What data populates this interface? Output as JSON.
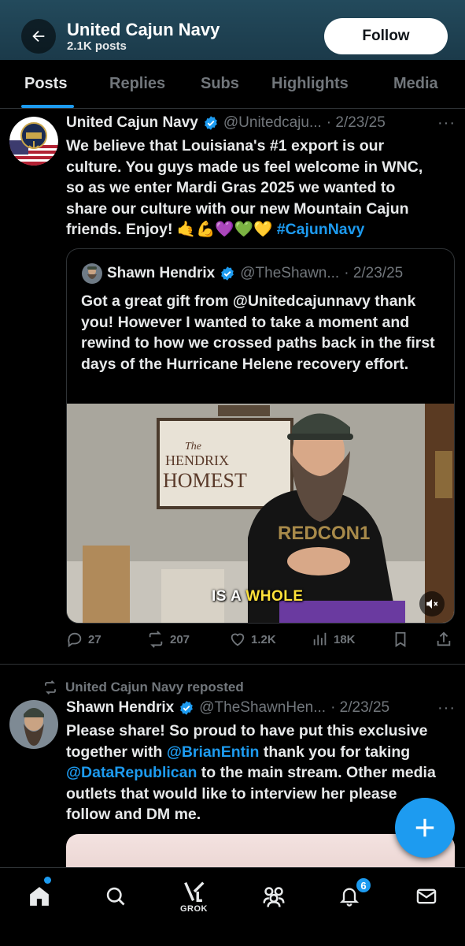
{
  "header": {
    "title": "United Cajun Navy",
    "posts_count": "2.1K posts",
    "follow_label": "Follow"
  },
  "tabs": [
    {
      "label": "Posts",
      "active": true
    },
    {
      "label": "Replies",
      "active": false
    },
    {
      "label": "Subs",
      "active": false
    },
    {
      "label": "Highlights",
      "active": false
    },
    {
      "label": "Media",
      "active": false
    }
  ],
  "post1": {
    "name": "United Cajun Navy",
    "handle": "@Unitedcaju...",
    "date": "· 2/23/25",
    "text_main": "We believe that Louisiana's #1 export is our culture. You guys made us feel welcome in WNC, so as we enter Mardi Gras 2025 we wanted to share our culture with our new Mountain Cajun friends. Enjoy! ",
    "emojis": "🤙💪💜💚💛",
    "hashtag": "#CajunNavy",
    "quote": {
      "name": "Shawn Hendrix",
      "handle": "@TheShawn...",
      "date": "· 2/23/25",
      "text": "Got a great gift from @Unitedcajunnavy thank you! However I wanted to take a moment and rewind to how we crossed paths back in the first days of the Hurricane Helene recovery effort.",
      "caption_pre": "IS A ",
      "caption_hl": "WHOLE"
    },
    "stats": {
      "replies": "27",
      "reposts": "207",
      "likes": "1.2K",
      "views": "18K"
    }
  },
  "post2": {
    "reposted_by": "United Cajun Navy reposted",
    "name": "Shawn Hendrix",
    "handle": "@TheShawnHen...",
    "date": "· 2/23/25",
    "text_1": "Please share! So proud to have put this exclusive together with ",
    "mention_1": "@BrianEntin",
    "text_2": " thank you for taking ",
    "mention_2": "@DataRepublican",
    "text_3": " to the main stream. Other media outlets that would like to interview her please follow and DM me."
  },
  "nav": {
    "grok_label": "GROK",
    "notifications_badge": "6",
    "items": [
      "home-icon",
      "search-icon",
      "grok-icon",
      "communities-icon",
      "bell-icon",
      "mail-icon"
    ]
  },
  "colors": {
    "accent": "#1d9bf0",
    "header_bg": "#1b3a4a",
    "background": "#000000",
    "muted": "#71767b"
  }
}
